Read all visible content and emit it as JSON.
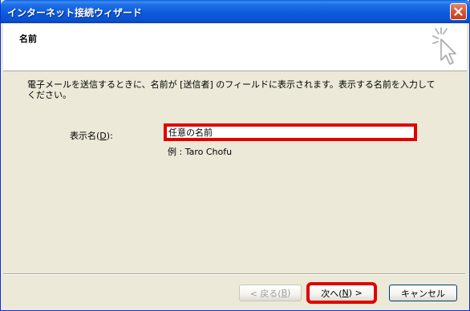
{
  "window": {
    "title": "インターネット接続ウィザード",
    "close_icon": "close-icon"
  },
  "header": {
    "title": "名前",
    "icon": "wizard-cursor-icon"
  },
  "main": {
    "instruction": "電子メールを送信するときに、名前が [送信者] のフィールドに表示されます。表示する名前を入力してください。",
    "display_name_label_before": "表示名(",
    "display_name_label_key": "D",
    "display_name_label_after": "):",
    "display_name_value": "任意の名前",
    "example": "例 : Taro Chofu"
  },
  "buttons": {
    "back_before": "< 戻る(",
    "back_key": "B",
    "back_after": ")",
    "next_before": "次へ(",
    "next_key": "N",
    "next_after": ") >",
    "cancel": "キャンセル"
  },
  "colors": {
    "titlebar": "#0a52d0",
    "highlight": "#e00000",
    "dialog_bg": "#ece9d8"
  }
}
